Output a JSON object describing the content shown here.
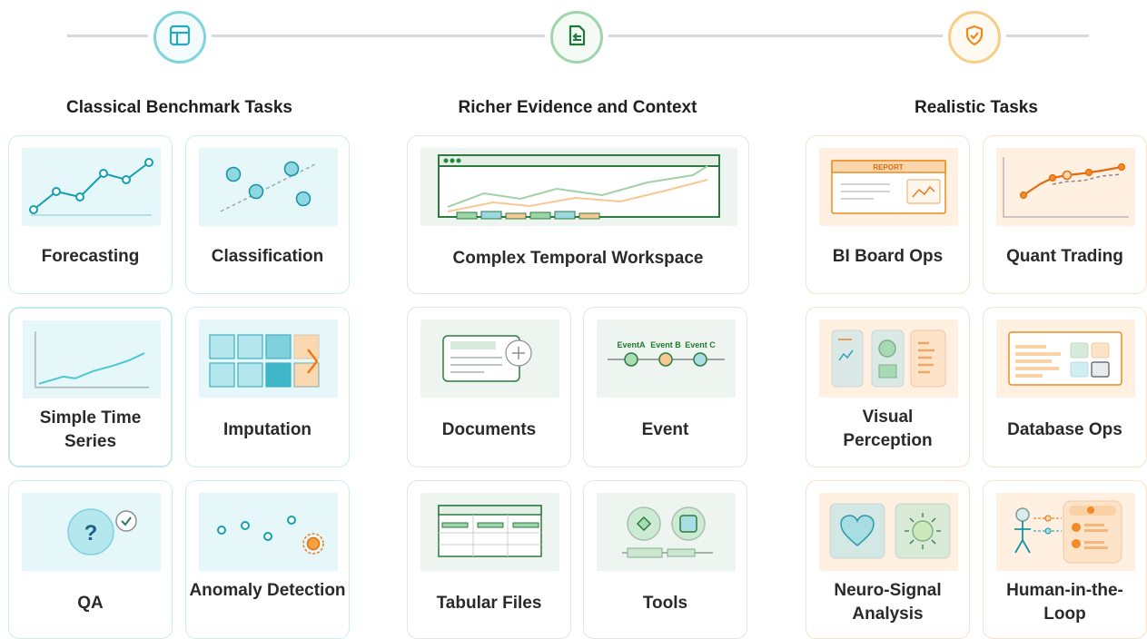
{
  "timeline": {
    "stages": [
      {
        "icon": "layout-icon",
        "color": "#3fb6c9",
        "heading": "Classical Benchmark Tasks"
      },
      {
        "icon": "document-icon",
        "color": "#3e9e5c",
        "heading": "Richer Evidence and Context"
      },
      {
        "icon": "shield-check-icon",
        "color": "#f29a37",
        "heading": "Realistic Tasks"
      }
    ]
  },
  "classical": {
    "forecasting": "Forecasting",
    "classification": "Classification",
    "simple_time_series": "Simple Time Series",
    "imputation": "Imputation",
    "qa": "QA",
    "anomaly_detection": "Anomaly Detection"
  },
  "richer": {
    "workspace": "Complex Temporal Workspace",
    "documents": "Documents",
    "event": "Event",
    "tabular_files": "Tabular Files",
    "tools": "Tools",
    "event_labels": [
      "EventA",
      "Event B",
      "Event C"
    ]
  },
  "realistic": {
    "bi_board": "BI Board Ops",
    "quant": "Quant Trading",
    "visual_perception": "Visual Perception",
    "database": "Database Ops",
    "neuro": "Neuro-Signal Analysis",
    "hitl": "Human-in-the-Loop",
    "report_label": "REPORT"
  }
}
